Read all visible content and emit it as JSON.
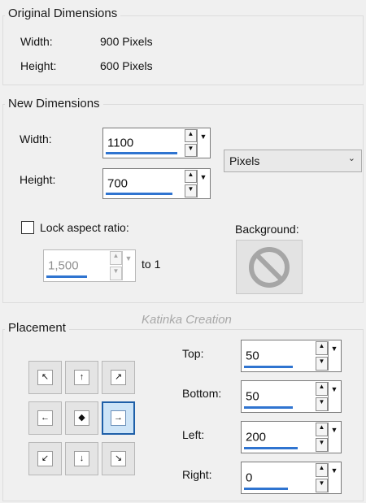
{
  "original": {
    "title": "Original Dimensions",
    "width_label": "Width:",
    "width_value": "900 Pixels",
    "height_label": "Height:",
    "height_value": "600 Pixels"
  },
  "new_dims": {
    "title": "New Dimensions",
    "width_label": "Width:",
    "width_value": "1100",
    "height_label": "Height:",
    "height_value": "700",
    "unit": "Pixels",
    "lock_label": "Lock aspect ratio:",
    "lock_checked": false,
    "ratio_value": "1,500",
    "ratio_suffix": "to 1",
    "background_label": "Background:"
  },
  "watermark": "Katinka Creation",
  "placement": {
    "title": "Placement",
    "top_label": "Top:",
    "top_value": "50",
    "bottom_label": "Bottom:",
    "bottom_value": "50",
    "left_label": "Left:",
    "left_value": "200",
    "right_label": "Right:",
    "right_value": "0",
    "selected": "middle-right"
  },
  "icons": {
    "spin_up": "up-arrow-icon",
    "spin_down": "down-arrow-icon",
    "dropdown": "dropdown-arrow-icon",
    "no_background": "no-symbol-icon"
  },
  "colors": {
    "accent": "#2f74d0",
    "selected_bg": "#cde4f7",
    "selected_border": "#1e5fa8"
  }
}
